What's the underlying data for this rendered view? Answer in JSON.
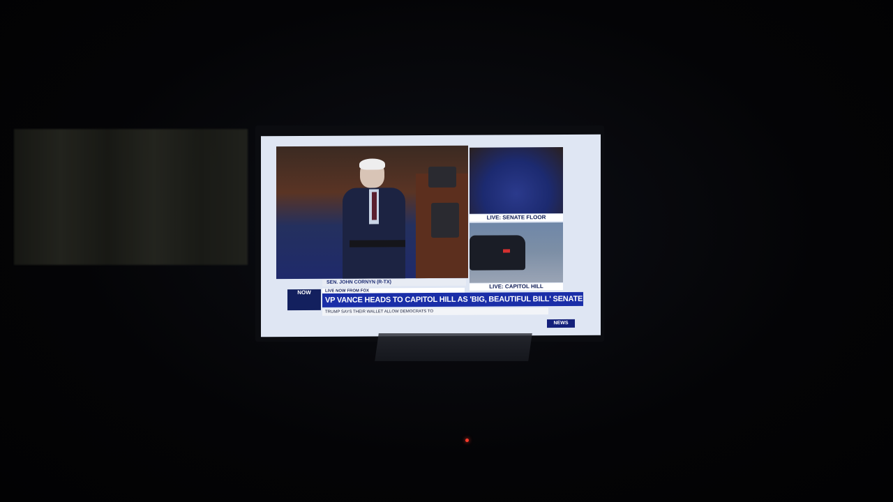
{
  "scene": {
    "description_colors": {
      "screen_bg": "#dfe6f3",
      "headline_blue": "#1a2ea8",
      "live_led": "#ff3a2a"
    }
  },
  "broadcast": {
    "panel_top_right_label": "LIVE: SENATE FLOOR",
    "panel_bottom_right_label": "LIVE: CAPITOL HILL",
    "speaker_lower_third": "SEN. JOHN CORNYN (R-TX)",
    "live_tag": "LIVE NOW FROM FOX",
    "headline": "VP VANCE HEADS TO CAPITOL HILL AS 'BIG, BEAUTIFUL BILL' SENATE VOTE LOOMS",
    "logo_text": "NOW",
    "ticker_text": "TRUMP SAYS THEIR WALLET ALLOW DEMOCRATS TO",
    "news_badge": "NEWS"
  }
}
